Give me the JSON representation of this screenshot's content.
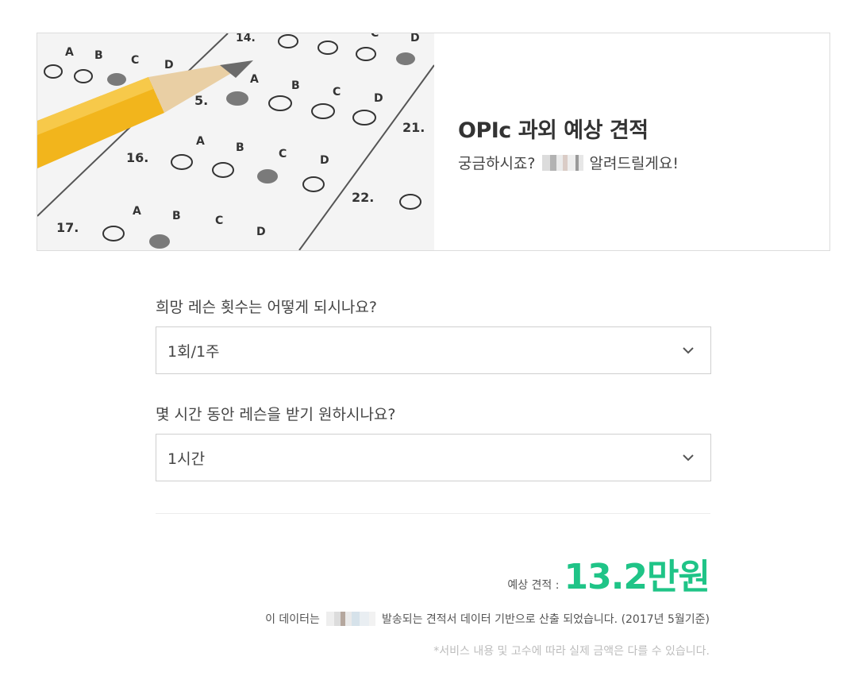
{
  "hero": {
    "title": "OPIc 과외 예상 견적",
    "subtitle_prefix": "궁금하시죠?",
    "subtitle_suffix": "알려드릴게요!",
    "image_icon": "answer-sheet-with-pencil"
  },
  "questions": [
    {
      "label": "희망 레슨 횟수는 어떻게 되시나요?",
      "selected": "1회/1주"
    },
    {
      "label": "몇 시간 동안 레슨을 받기 원하시나요?",
      "selected": "1시간"
    }
  ],
  "estimate": {
    "label": "예상 견적 :",
    "value": "13.2만원",
    "color": "#1fc487"
  },
  "note": {
    "prefix": "이 데이터는",
    "suffix": "발송되는 견적서 데이터 기반으로 산출 되었습니다. (2017년 5월기준)"
  },
  "disclaimer": "*서비스 내용 및 고수에 따라 실제 금액은 다를 수 있습니다."
}
